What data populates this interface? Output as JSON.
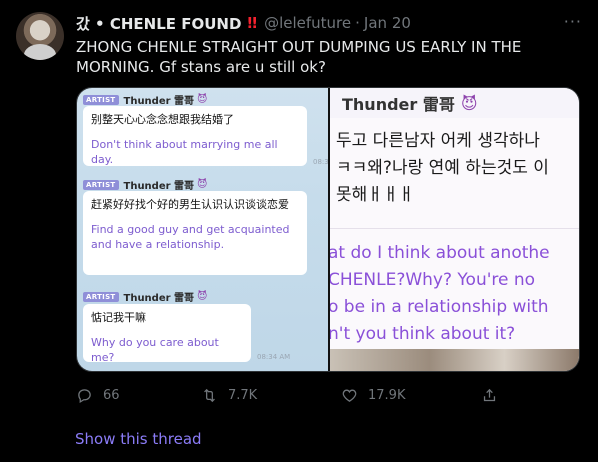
{
  "tweet": {
    "author_name": "갔 • CHENLE FOUND",
    "warning_emoji": "!!",
    "handle": "@lelefuture",
    "separator": "·",
    "date": "Jan 20",
    "more_icon": "···",
    "text": "ZHONG CHENLE STRAIGHT OUT DUMPING US EARLY IN THE MORNING. Gf stans are u still ok?"
  },
  "media": {
    "left": {
      "messages": [
        {
          "badge": "ARTIST",
          "sender": "Thunder 雷哥",
          "sender_icon": "devil-emoji",
          "chinese": "别整天心心念念想跟我结婚了",
          "english": "Don't think about marrying me all day.",
          "time": "08:3"
        },
        {
          "badge": "ARTIST",
          "sender": "Thunder 雷哥",
          "sender_icon": "devil-emoji",
          "chinese": "赶紧好好找个好的男生认识认识谈谈恋爱",
          "english": "Find a good guy and get acquainted and have a relationship.",
          "time": ""
        },
        {
          "badge": "ARTIST",
          "sender": "Thunder 雷哥",
          "sender_icon": "devil-emoji",
          "chinese": "惦记我干嘛",
          "english": "Why do you care about me?",
          "time": "08:34 AM"
        }
      ]
    },
    "right": {
      "sender": "Thunder 雷哥",
      "sender_icon": "devil-emoji",
      "korean_lines": [
        "두고 다른남자 어케 생각하나",
        "ㅋㅋ왜?나랑 연예 하는것도 이",
        "못해ㅐㅐㅐ"
      ],
      "english_lines": [
        "at do I think about anothe",
        "CHENLE?Why? You're no",
        "o be in a relationship with",
        "n't you think about it?"
      ]
    }
  },
  "actions": {
    "reply_count": "66",
    "retweet_count": "7.7K",
    "like_count": "17.9K"
  },
  "show_thread": "Show this thread",
  "colors": {
    "background": "#000000",
    "text": "#e7e9ea",
    "muted": "#71767b",
    "accent": "#8b7cf7",
    "warning": "#f4212e",
    "chat_english": "#7d5ccf"
  }
}
